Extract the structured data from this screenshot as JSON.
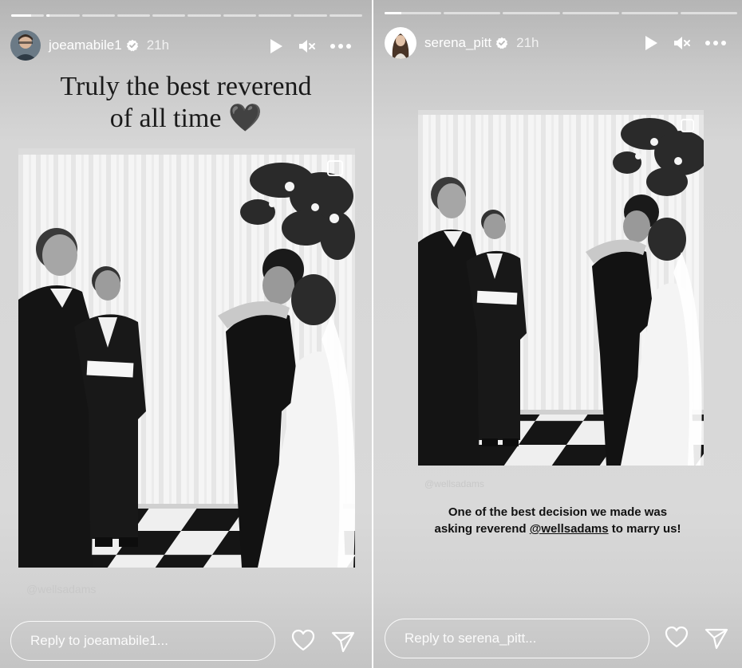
{
  "left_story": {
    "progress": [
      0.6,
      0.1,
      0,
      0,
      0,
      0,
      0,
      0,
      0,
      0
    ],
    "username": "joeamabile1",
    "time": "21h",
    "caption_line1": "Truly the best reverend",
    "caption_line2": "of all time 🖤",
    "mention": "@wellsadams",
    "reply_placeholder": "Reply to joeamabile1..."
  },
  "right_story": {
    "progress": [
      0.3,
      0,
      0,
      0,
      0,
      0
    ],
    "username": "serena_pitt",
    "time": "21h",
    "mention": "@wellsadams",
    "text_line1": "One of the best decision we made was",
    "text_line2_pre": "asking reverend ",
    "text_line2_link": "@wellsadams",
    "text_line2_post": " to marry us!",
    "reply_placeholder": "Reply to serena_pitt..."
  },
  "icons": {
    "verified": "verified-badge-icon",
    "play": "play-icon",
    "mute": "muted-speaker-icon",
    "more": "more-horizontal-icon",
    "like": "heart-icon",
    "share": "send-icon"
  }
}
